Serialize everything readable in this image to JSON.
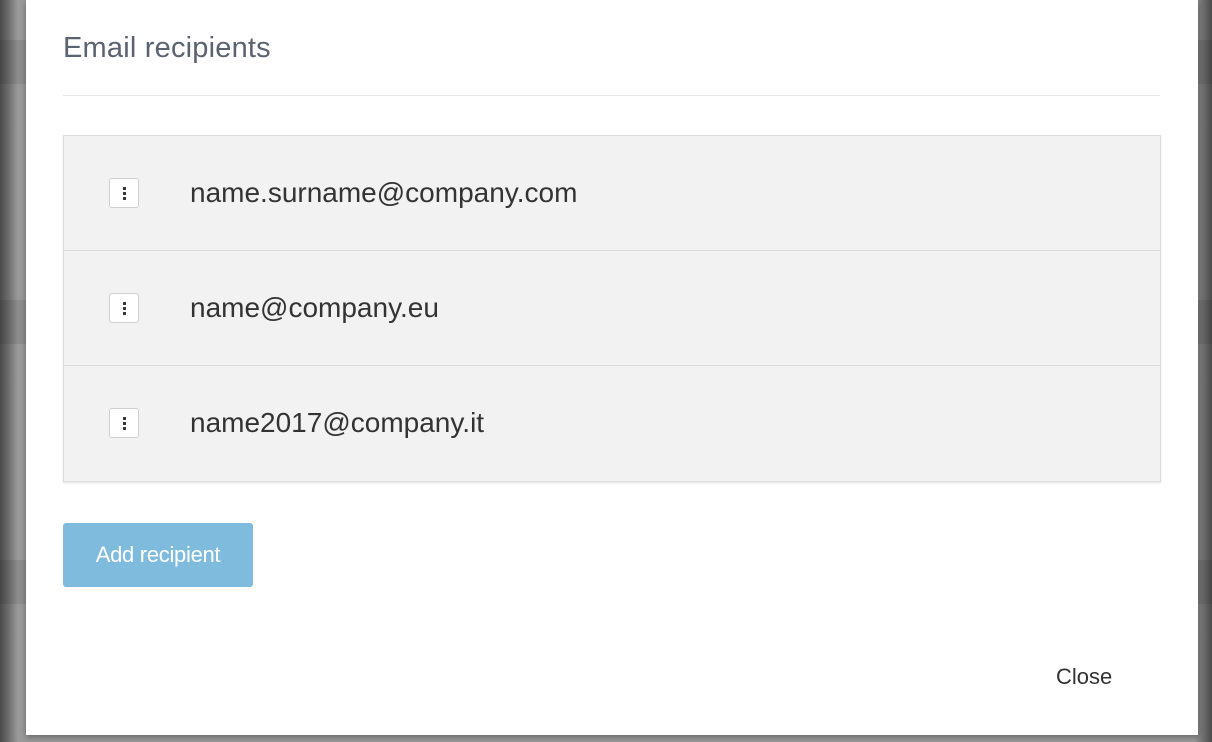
{
  "modal": {
    "title": "Email recipients",
    "recipients": [
      {
        "email": "name.surname@company.com",
        "menu_icon": "vertical-ellipsis-icon"
      },
      {
        "email": "name@company.eu",
        "menu_icon": "vertical-ellipsis-icon"
      },
      {
        "email": "name2017@company.it",
        "menu_icon": "vertical-ellipsis-icon"
      }
    ],
    "add_button_label": "Add recipient",
    "close_button_label": "Close"
  },
  "colors": {
    "accent_button": "#7fbbdc",
    "title_text": "#5b6270",
    "row_background": "#f2f2f2"
  }
}
